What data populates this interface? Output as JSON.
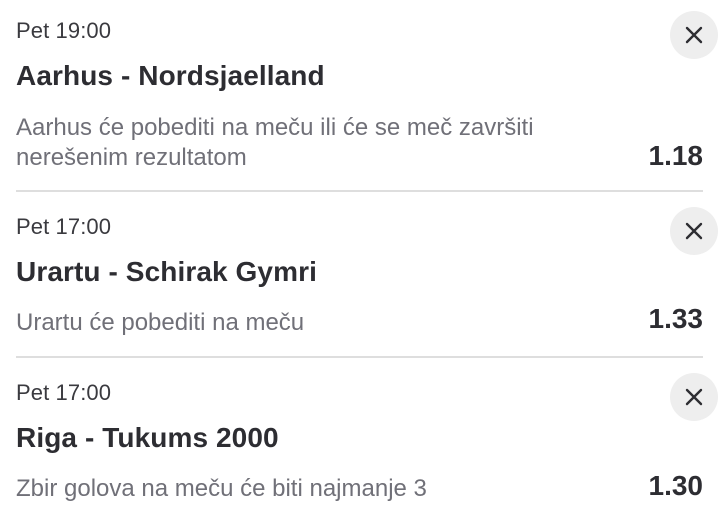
{
  "bets": [
    {
      "time": "Pet 19:00",
      "match": "Aarhus - Nordsjaelland",
      "pick": "Aarhus će pobediti na meču ili će se meč završiti nerešenim rezultatom",
      "odds": "1.18",
      "remove_icon": "close-icon"
    },
    {
      "time": "Pet 17:00",
      "match": "Urartu - Schirak Gymri",
      "pick": "Urartu će pobediti na meču",
      "odds": "1.33",
      "remove_icon": "close-icon"
    },
    {
      "time": "Pet 17:00",
      "match": "Riga - Tukums 2000",
      "pick": "Zbir golova na meču će biti najmanje 3",
      "odds": "1.30",
      "remove_icon": "close-icon"
    }
  ],
  "colors": {
    "text_primary": "#2d2d32",
    "text_secondary": "#707078",
    "divider": "#dedede",
    "remove_button_bg": "#eeeeee"
  }
}
